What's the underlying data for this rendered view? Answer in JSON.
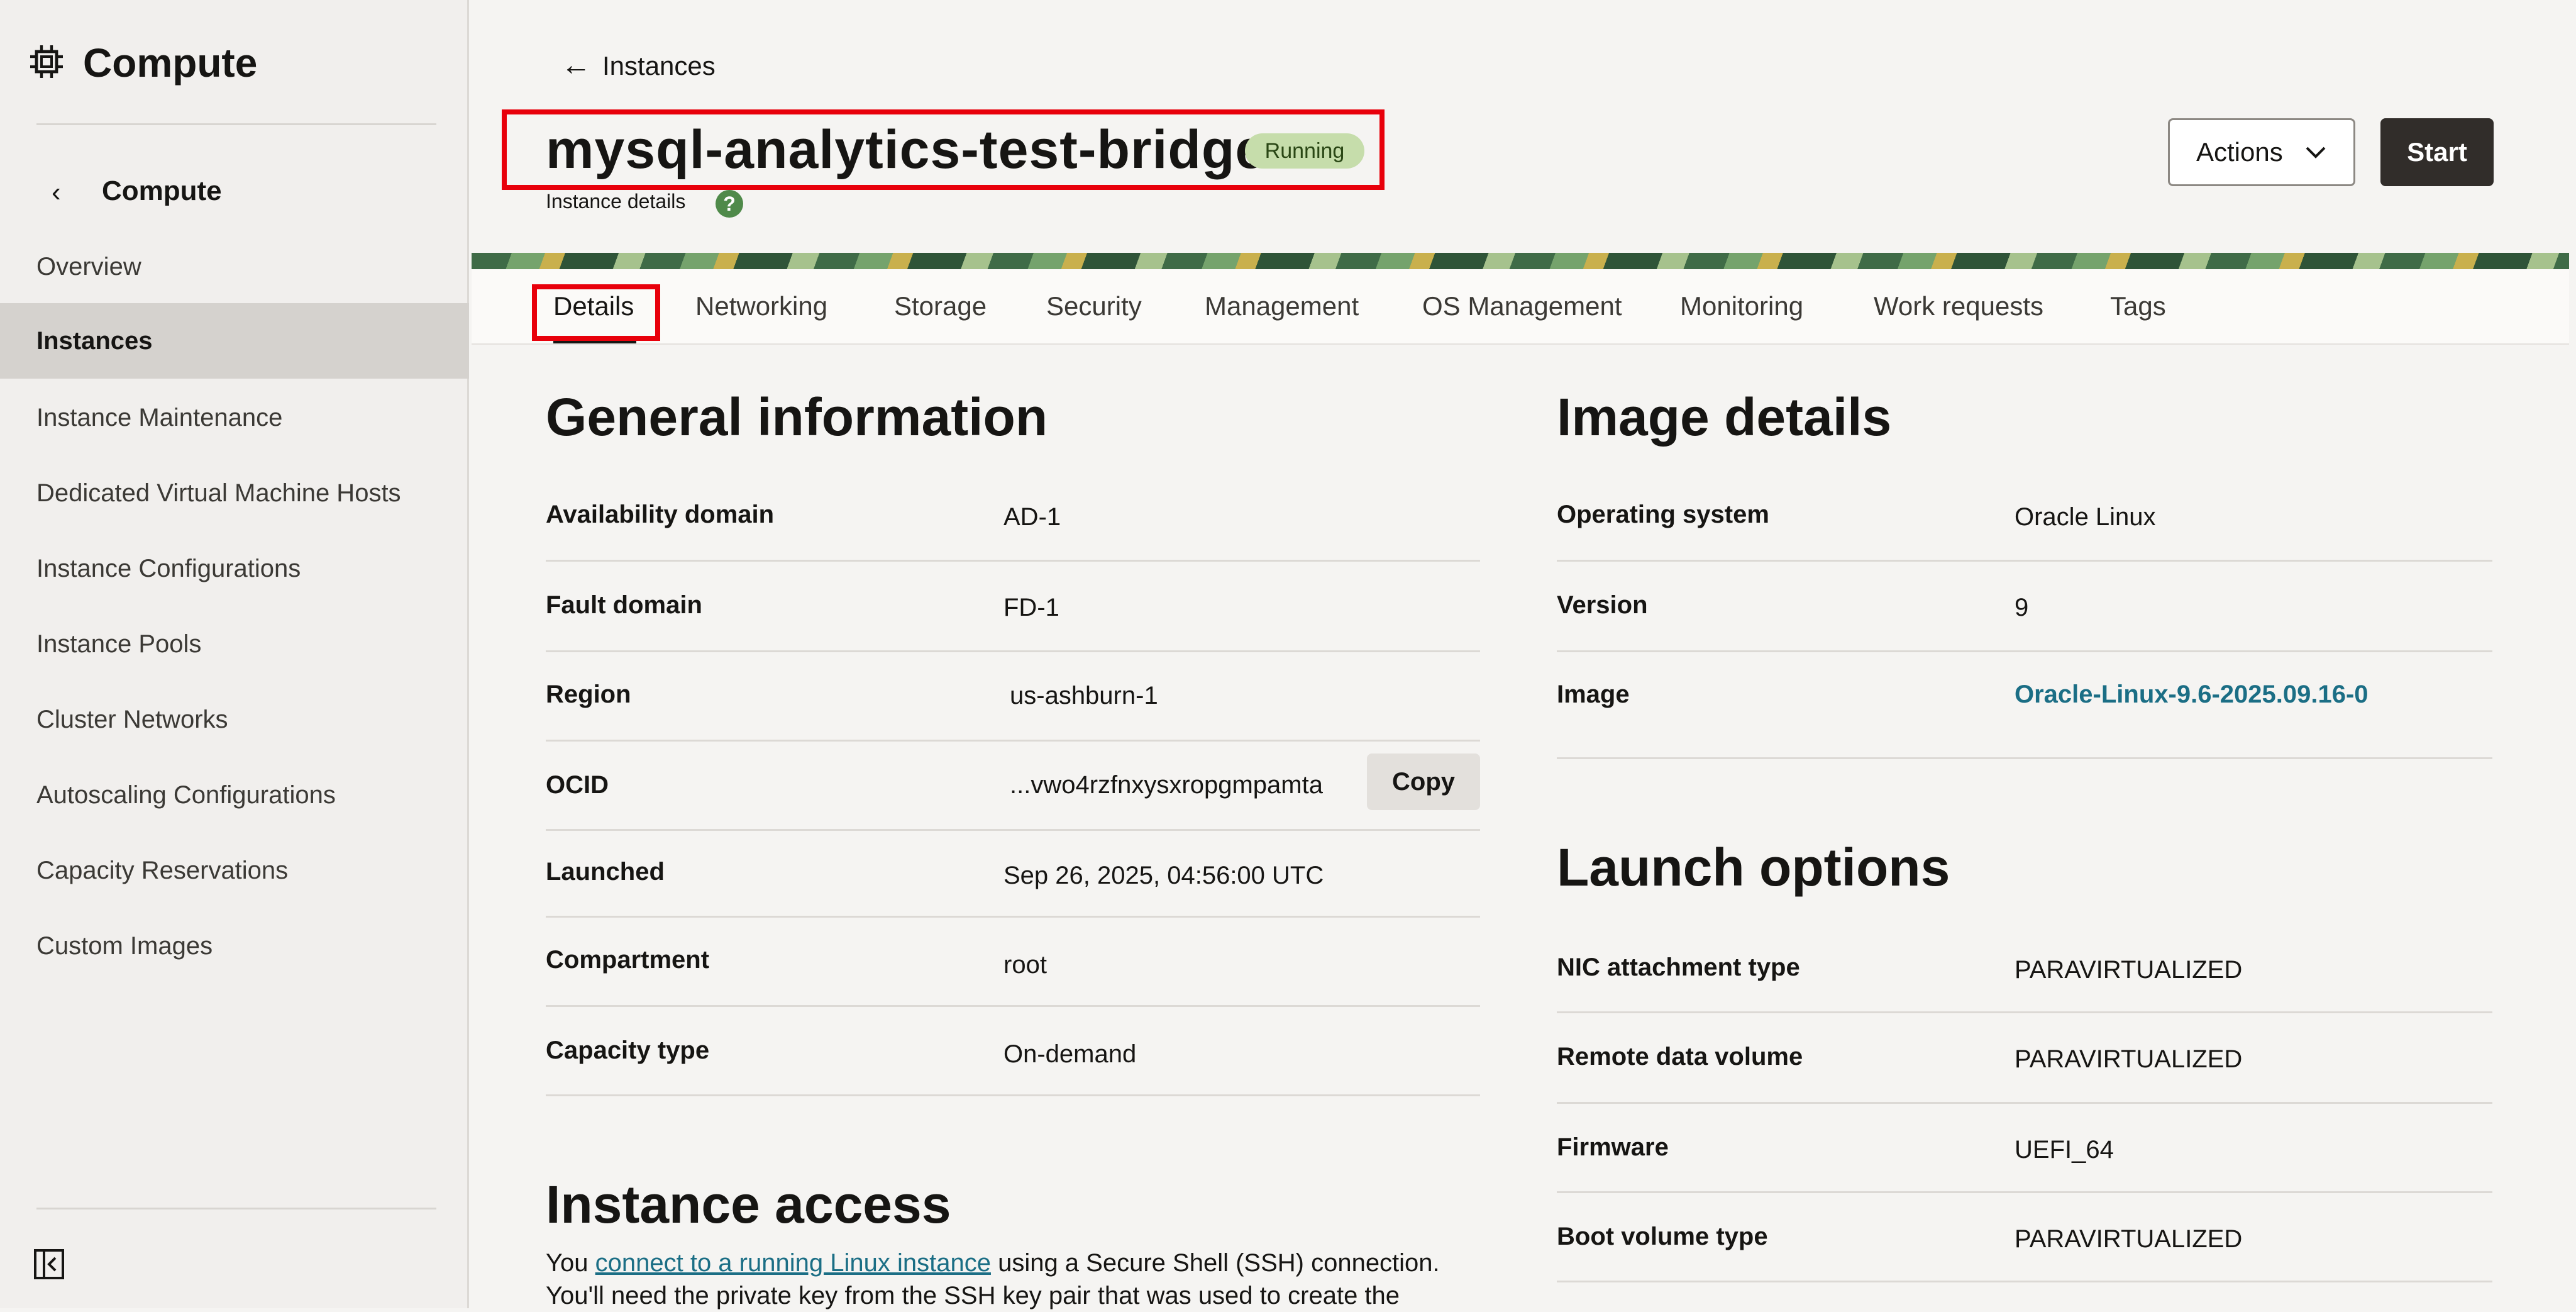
{
  "sidebar": {
    "title": "Compute",
    "sub_title": "Compute",
    "back_icon": "chevron-left-icon",
    "items": [
      {
        "label": "Overview",
        "active": false
      },
      {
        "label": "Instances",
        "active": true
      },
      {
        "label": "Instance Maintenance",
        "active": false
      },
      {
        "label": "Dedicated Virtual Machine Hosts",
        "active": false
      },
      {
        "label": "Instance Configurations",
        "active": false
      },
      {
        "label": "Instance Pools",
        "active": false
      },
      {
        "label": "Cluster Networks",
        "active": false
      },
      {
        "label": "Autoscaling Configurations",
        "active": false
      },
      {
        "label": "Capacity Reservations",
        "active": false
      },
      {
        "label": "Custom Images",
        "active": false
      }
    ]
  },
  "header": {
    "back_label": "Instances",
    "title": "mysql-analytics-test-bridge",
    "status": "Running",
    "status_color": "#c6ddab",
    "subtitle": "Instance details",
    "help": "?",
    "actions_label": "Actions",
    "start_label": "Start"
  },
  "tabs": [
    {
      "label": "Details",
      "active": true
    },
    {
      "label": "Networking",
      "active": false
    },
    {
      "label": "Storage",
      "active": false
    },
    {
      "label": "Security",
      "active": false
    },
    {
      "label": "Management",
      "active": false
    },
    {
      "label": "OS Management",
      "active": false
    },
    {
      "label": "Monitoring",
      "active": false
    },
    {
      "label": "Work requests",
      "active": false
    },
    {
      "label": "Tags",
      "active": false
    }
  ],
  "general": {
    "heading": "General information",
    "rows": [
      {
        "label": "Availability domain",
        "value": "AD-1"
      },
      {
        "label": "Fault domain",
        "value": "FD-1"
      },
      {
        "label": "Region",
        "value": "us-ashburn-1"
      },
      {
        "label": "OCID",
        "value": "...vwo4rzfnxysxropgmpamta"
      },
      {
        "label": "Launched",
        "value": "Sep 26, 2025, 04:56:00 UTC"
      },
      {
        "label": "Compartment",
        "value": "root"
      },
      {
        "label": "Capacity type",
        "value": "On-demand"
      }
    ],
    "copy_label": "Copy"
  },
  "image": {
    "heading": "Image details",
    "rows": [
      {
        "label": "Operating system",
        "value": "Oracle Linux"
      },
      {
        "label": "Version",
        "value": "9"
      },
      {
        "label": "Image",
        "value": "Oracle-Linux-9.6-2025.09.16-0"
      }
    ]
  },
  "launch": {
    "heading": "Launch options",
    "rows": [
      {
        "label": "NIC attachment type",
        "value": "PARAVIRTUALIZED"
      },
      {
        "label": "Remote data volume",
        "value": "PARAVIRTUALIZED"
      },
      {
        "label": "Firmware",
        "value": "UEFI_64"
      },
      {
        "label": "Boot volume type",
        "value": "PARAVIRTUALIZED"
      }
    ]
  },
  "access": {
    "heading": "Instance access",
    "text_before": "You ",
    "link": "connect to a running Linux instance",
    "text_after": " using a Secure Shell (SSH) connection. You'll need the private key from the SSH key pair that was used to create the"
  },
  "colors": {
    "highlight": "#e8000b",
    "link": "#1b6e85",
    "start_button": "#312d2a"
  }
}
